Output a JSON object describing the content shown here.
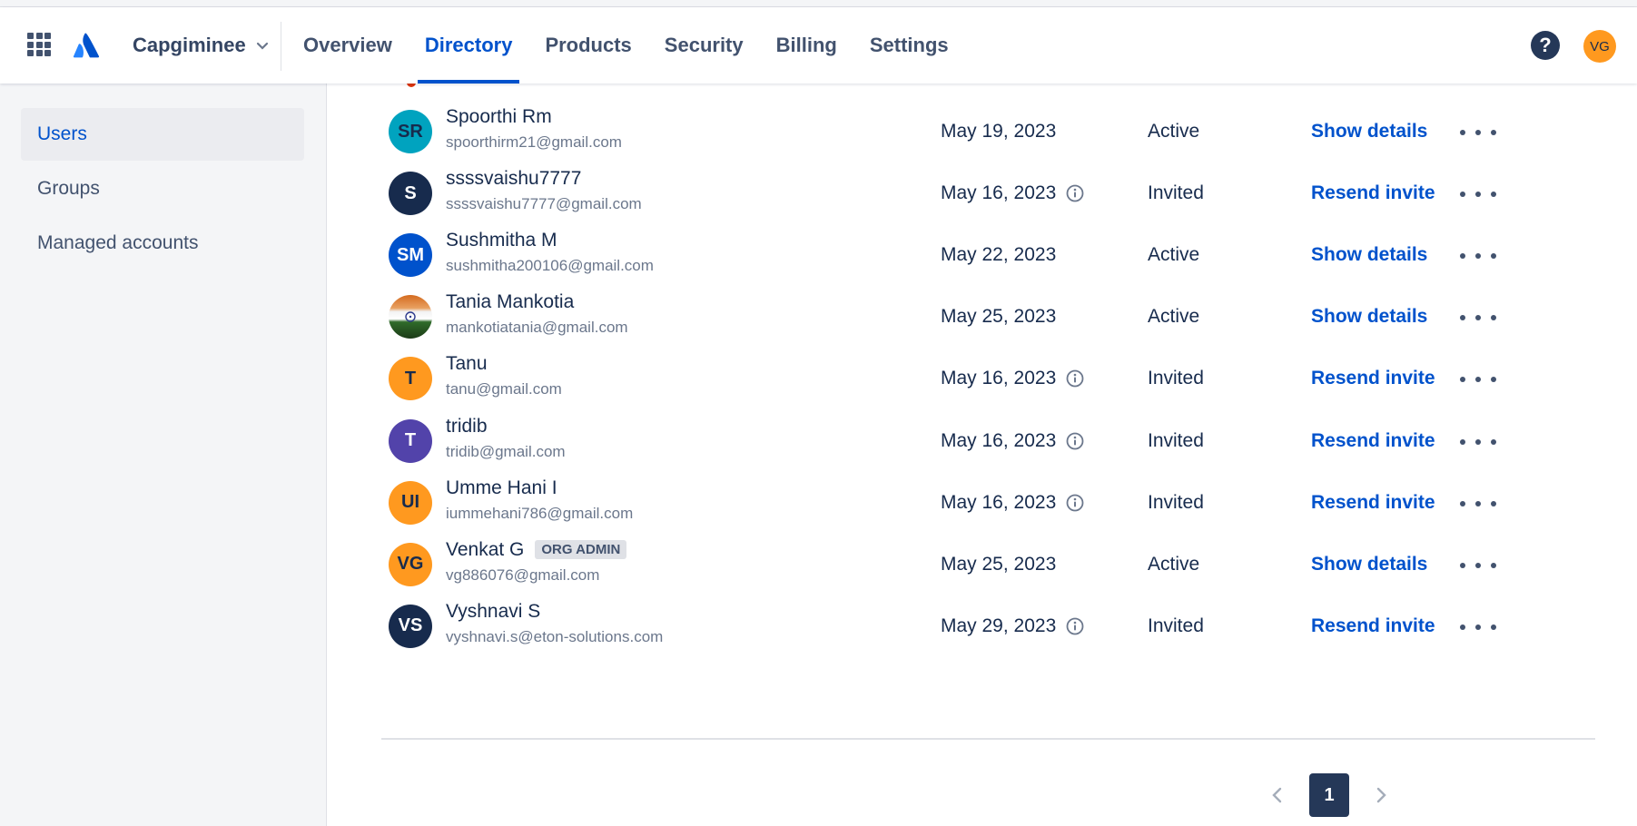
{
  "header": {
    "org_name": "Capgiminee",
    "tabs": [
      {
        "label": "Overview"
      },
      {
        "label": "Directory"
      },
      {
        "label": "Products"
      },
      {
        "label": "Security"
      },
      {
        "label": "Billing"
      },
      {
        "label": "Settings"
      }
    ],
    "active_tab": "Directory",
    "help_glyph": "?",
    "avatar_initials": "VG"
  },
  "sidebar": {
    "items": [
      {
        "label": "Users"
      },
      {
        "label": "Groups"
      },
      {
        "label": "Managed accounts"
      }
    ],
    "active_item": "Users"
  },
  "users": [
    {
      "initials": "SR",
      "name": "Spoorthi Rm",
      "email": "spoorthirm21@gmail.com",
      "date": "May 19, 2023",
      "status": "Active",
      "action": "Show details",
      "avatar_color": "#00a3bf",
      "avatar_text_color": "#172b4d"
    },
    {
      "initials": "S",
      "name": "ssssvaishu7777",
      "email": "ssssvaishu7777@gmail.com",
      "date": "May 16, 2023",
      "status": "Invited",
      "action": "Resend invite",
      "avatar_color": "#172b4d",
      "avatar_text_color": "#ffffff"
    },
    {
      "initials": "SM",
      "name": "Sushmitha M",
      "email": "sushmitha200106@gmail.com",
      "date": "May 22, 2023",
      "status": "Active",
      "action": "Show details",
      "avatar_color": "#0052cc",
      "avatar_text_color": "#ffffff"
    },
    {
      "initials": "",
      "name": "Tania Mankotia",
      "email": "mankotiatania@gmail.com",
      "date": "May 25, 2023",
      "status": "Active",
      "action": "Show details",
      "avatar_color": "flag",
      "avatar_text_color": "#ffffff"
    },
    {
      "initials": "T",
      "name": "Tanu",
      "email": "tanu@gmail.com",
      "date": "May 16, 2023",
      "status": "Invited",
      "action": "Resend invite",
      "avatar_color": "#ff991f",
      "avatar_text_color": "#172b4d"
    },
    {
      "initials": "T",
      "name": "tridib",
      "email": "tridib@gmail.com",
      "date": "May 16, 2023",
      "status": "Invited",
      "action": "Resend invite",
      "avatar_color": "#5243aa",
      "avatar_text_color": "#ffffff"
    },
    {
      "initials": "UI",
      "name": "Umme Hani I",
      "email": "iummehani786@gmail.com",
      "date": "May 16, 2023",
      "status": "Invited",
      "action": "Resend invite",
      "avatar_color": "#ff991f",
      "avatar_text_color": "#172b4d"
    },
    {
      "initials": "VG",
      "name": "Venkat G",
      "email": "vg886076@gmail.com",
      "date": "May 25, 2023",
      "status": "Active",
      "action": "Show details",
      "avatar_color": "#ff991f",
      "avatar_text_color": "#172b4d",
      "badge": "ORG ADMIN"
    },
    {
      "initials": "VS",
      "name": "Vyshnavi S",
      "email": "vyshnavi.s@eton-solutions.com",
      "date": "May 29, 2023",
      "status": "Invited",
      "action": "Resend invite",
      "avatar_color": "#172b4d",
      "avatar_text_color": "#ffffff"
    }
  ],
  "pagination": {
    "current_page": "1"
  },
  "colors": {
    "accent": "#0052cc",
    "text": "#172b4d",
    "subtle": "#6b778c"
  }
}
